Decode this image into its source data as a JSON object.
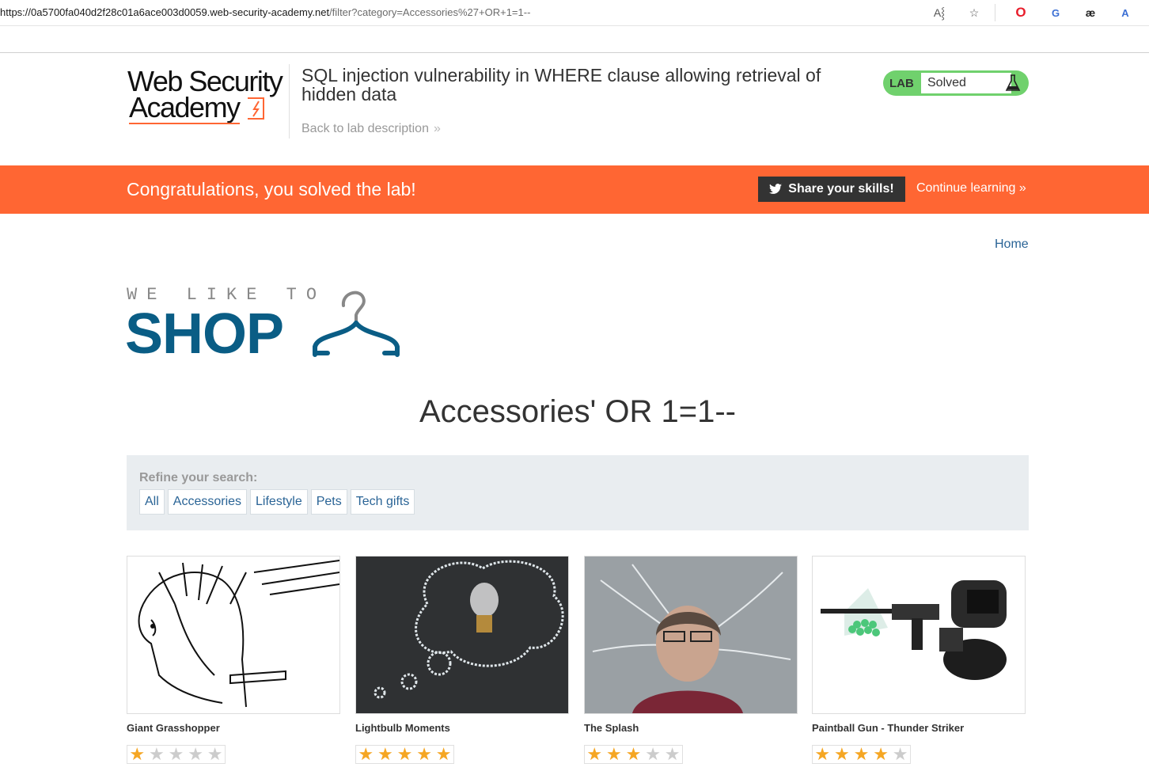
{
  "browser": {
    "url_host": "https://0a5700fa040d2f28c01a6ace003d0059.web-security-academy.net",
    "url_rest": "/filter?category=Accessories%27+OR+1=1--",
    "icons": [
      "read-aloud-icon",
      "favorite-star-icon",
      "opera-icon",
      "translate-icon",
      "ae-extension-icon",
      "translate-extension-icon"
    ]
  },
  "lab_header": {
    "logo_line1": "Web Security",
    "logo_line2": "Academy",
    "title": "SQL injection vulnerability in WHERE clause allowing retrieval of hidden data",
    "back_link": "Back to lab description",
    "status_label": "LAB",
    "status_value": "Solved"
  },
  "banner": {
    "message": "Congratulations, you solved the lab!",
    "share_label": "Share your skills!",
    "continue_label": "Continue learning"
  },
  "nav": {
    "home": "Home"
  },
  "shop_logo": {
    "tagline": "WE LIKE TO",
    "word": "SHOP"
  },
  "page": {
    "heading": "Accessories' OR 1=1--"
  },
  "refine": {
    "label": "Refine your search:",
    "filters": [
      "All",
      "Accessories",
      "Lifestyle",
      "Pets",
      "Tech gifts"
    ]
  },
  "products": [
    {
      "name": "Giant Grasshopper",
      "rating": 1
    },
    {
      "name": "Lightbulb Moments",
      "rating": 5
    },
    {
      "name": "The Splash",
      "rating": 3
    },
    {
      "name": "Paintball Gun - Thunder Striker",
      "rating": 4
    }
  ],
  "colors": {
    "accent_orange": "#ff6633",
    "brand_blue": "#0a5d85",
    "link_blue": "#2a6496",
    "solved_green": "#70d16d",
    "star_gold": "#f5a623"
  }
}
